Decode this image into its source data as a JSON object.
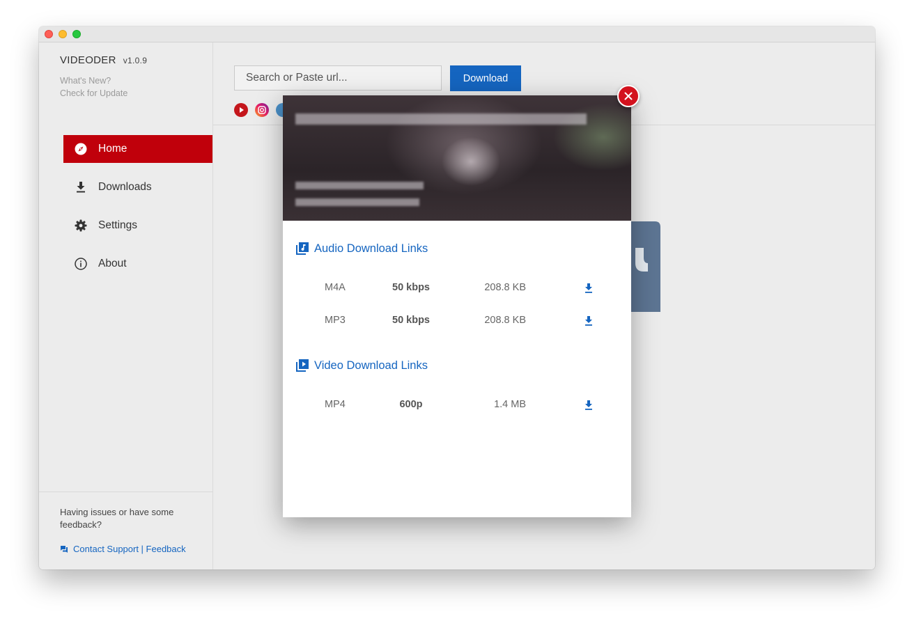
{
  "app": {
    "name": "VIDEODER",
    "version": "v1.0.9",
    "whats_new": "What's New?",
    "check_update": "Check for Update"
  },
  "nav": [
    {
      "label": "Home",
      "icon": "compass-icon",
      "active": true
    },
    {
      "label": "Downloads",
      "icon": "download-icon",
      "active": false
    },
    {
      "label": "Settings",
      "icon": "gear-icon",
      "active": false
    },
    {
      "label": "About",
      "icon": "info-icon",
      "active": false
    }
  ],
  "footer": {
    "feedback_prompt": "Having issues or have some feedback?",
    "contact_link": "Contact Support | Feedback"
  },
  "search": {
    "placeholder": "Search or Paste url...",
    "button_label": "Download"
  },
  "social_icons": [
    "youtube-icon",
    "instagram-icon",
    "twitter-icon"
  ],
  "modal": {
    "audio_title": "Audio Download Links",
    "video_title": "Video Download Links",
    "audio_links": [
      {
        "format": "M4A",
        "quality": "50 kbps",
        "size": "208.8 KB"
      },
      {
        "format": "MP3",
        "quality": "50 kbps",
        "size": "208.8 KB"
      }
    ],
    "video_links": [
      {
        "format": "MP4",
        "quality": "600p",
        "size": "1.4 MB"
      }
    ]
  },
  "colors": {
    "accent_red": "#c0000b",
    "accent_blue": "#1565c0",
    "close_red": "#d3121e"
  }
}
